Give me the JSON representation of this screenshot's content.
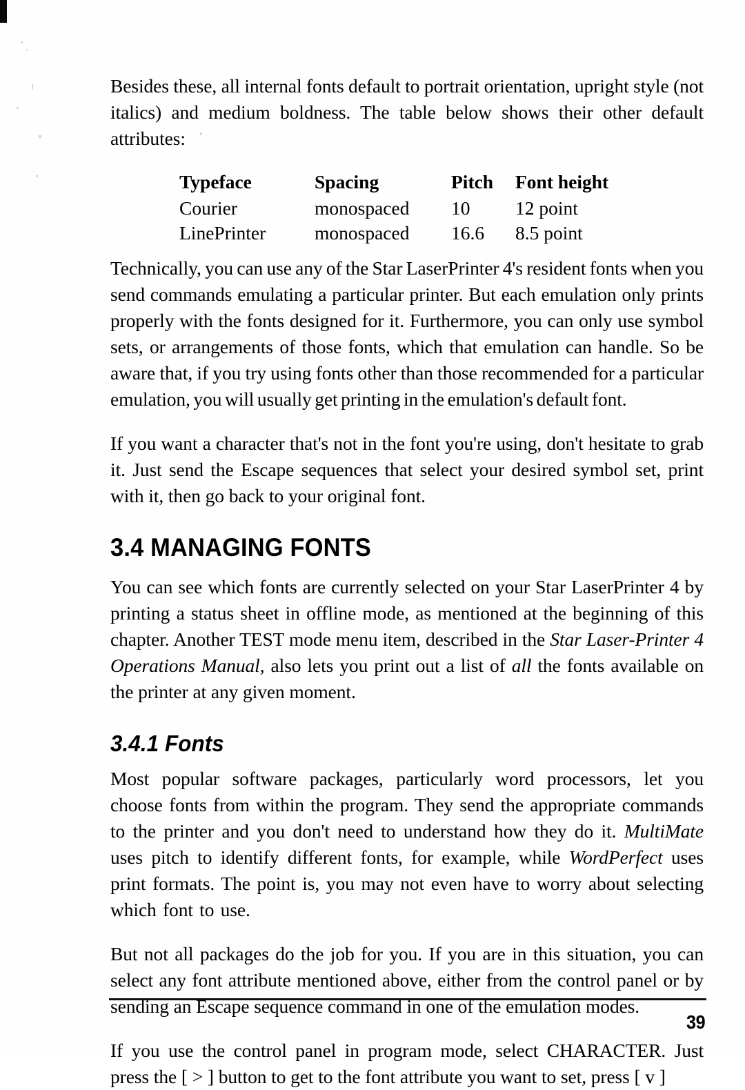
{
  "document": {
    "page_number": "39"
  },
  "paragraphs": {
    "intro": "Besides these, all internal fonts default to portrait orientation, upright style (not italics) and medium boldness. The table below shows their other default attributes:",
    "technically": "Technically, you can use any of the Star LaserPrinter 4's resident fonts when you send commands emulating a particular printer. But each emulation only prints properly with the fonts designed for it. Furthermore, you can only use symbol sets, or arrangements of those fonts, which that emulation can handle. So be aware that, if you try using fonts other than those recommended for a particular emulation, you will usually get printing in the emulation's default font.",
    "escape_sequences": "If you want a character that's not in the font you're using, don't hesitate to grab it. Just send the Escape sequences that select your desired symbol set, print with it, then go back to your original font.",
    "managing_fonts_p1_part1": "You can see which fonts are currently selected on your Star LaserPrinter 4 by printing a status sheet in offline mode, as mentioned at the beginning of this chapter. Another TEST mode menu item, described in the ",
    "managing_fonts_p1_italic1": "Star Laser-Printer 4 Operations Manual,",
    "managing_fonts_p1_part2": " also lets you print out a list of ",
    "managing_fonts_p1_italic2": "all",
    "managing_fonts_p1_part3": " the fonts available on the printer at any given moment.",
    "fonts_p1_part1": "Most popular software packages, particularly word processors, let you choose fonts from within the program. They send the appropriate commands to the printer and you don't need to understand how they do it. ",
    "fonts_p1_italic1": "MultiMate",
    "fonts_p1_part2": " uses pitch to identify different fonts, for example, while ",
    "fonts_p1_italic2": "WordPerfect",
    "fonts_p1_part3": " uses print formats. The point is, you may not even have to worry about selecting which font to use.",
    "fonts_p2": "But not all packages do the job for you. If you are in this situation, you can select any font attribute mentioned above, either from the control panel or by sending an Escape sequence command in one of the emulation modes.",
    "fonts_p3": "If you use the control panel in program mode, select CHARACTER. Just press the [ > ] button to get to the font attribute you want to set, press [ v ]"
  },
  "attributes_table": {
    "headers": [
      "Typeface",
      "Spacing",
      "Pitch",
      "Font height"
    ],
    "rows": [
      [
        "Courier",
        "monospaced",
        "10",
        "12 point"
      ],
      [
        "LinePrinter",
        "monospaced",
        "16.6",
        "8.5 point"
      ]
    ]
  },
  "headings": {
    "section": "3.4 MANAGING FONTS",
    "subsection": "3.4.1 Fonts"
  }
}
